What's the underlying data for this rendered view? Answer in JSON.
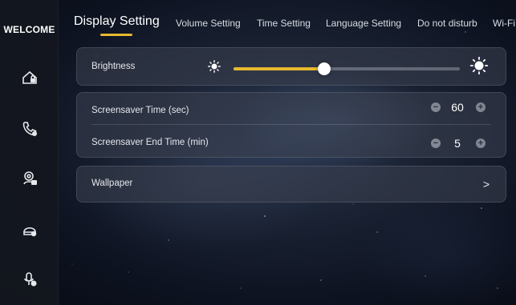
{
  "sidebar": {
    "title": "WELCOME",
    "items": [
      {
        "icon": "home-lock-icon"
      },
      {
        "icon": "phone-icon"
      },
      {
        "icon": "camera-user-icon"
      },
      {
        "icon": "speaker-icon"
      },
      {
        "icon": "mic-icon"
      }
    ]
  },
  "tabs": [
    {
      "label": "Display Setting",
      "active": true
    },
    {
      "label": "Volume Setting"
    },
    {
      "label": "Time Setting"
    },
    {
      "label": "Language Setting"
    },
    {
      "label": "Do not disturb"
    },
    {
      "label": "Wi-Fi"
    }
  ],
  "brightness": {
    "label": "Brightness",
    "level_fraction": 0.4
  },
  "screensaver": {
    "time_label": "Screensaver Time (sec)",
    "time_value": "60",
    "end_label": "Screensaver End Time (min)",
    "end_value": "5"
  },
  "wallpaper": {
    "label": "Wallpaper",
    "chevron": ">"
  },
  "colors": {
    "accent": "#e7b92f",
    "sidebar_bg": "#14171e"
  }
}
